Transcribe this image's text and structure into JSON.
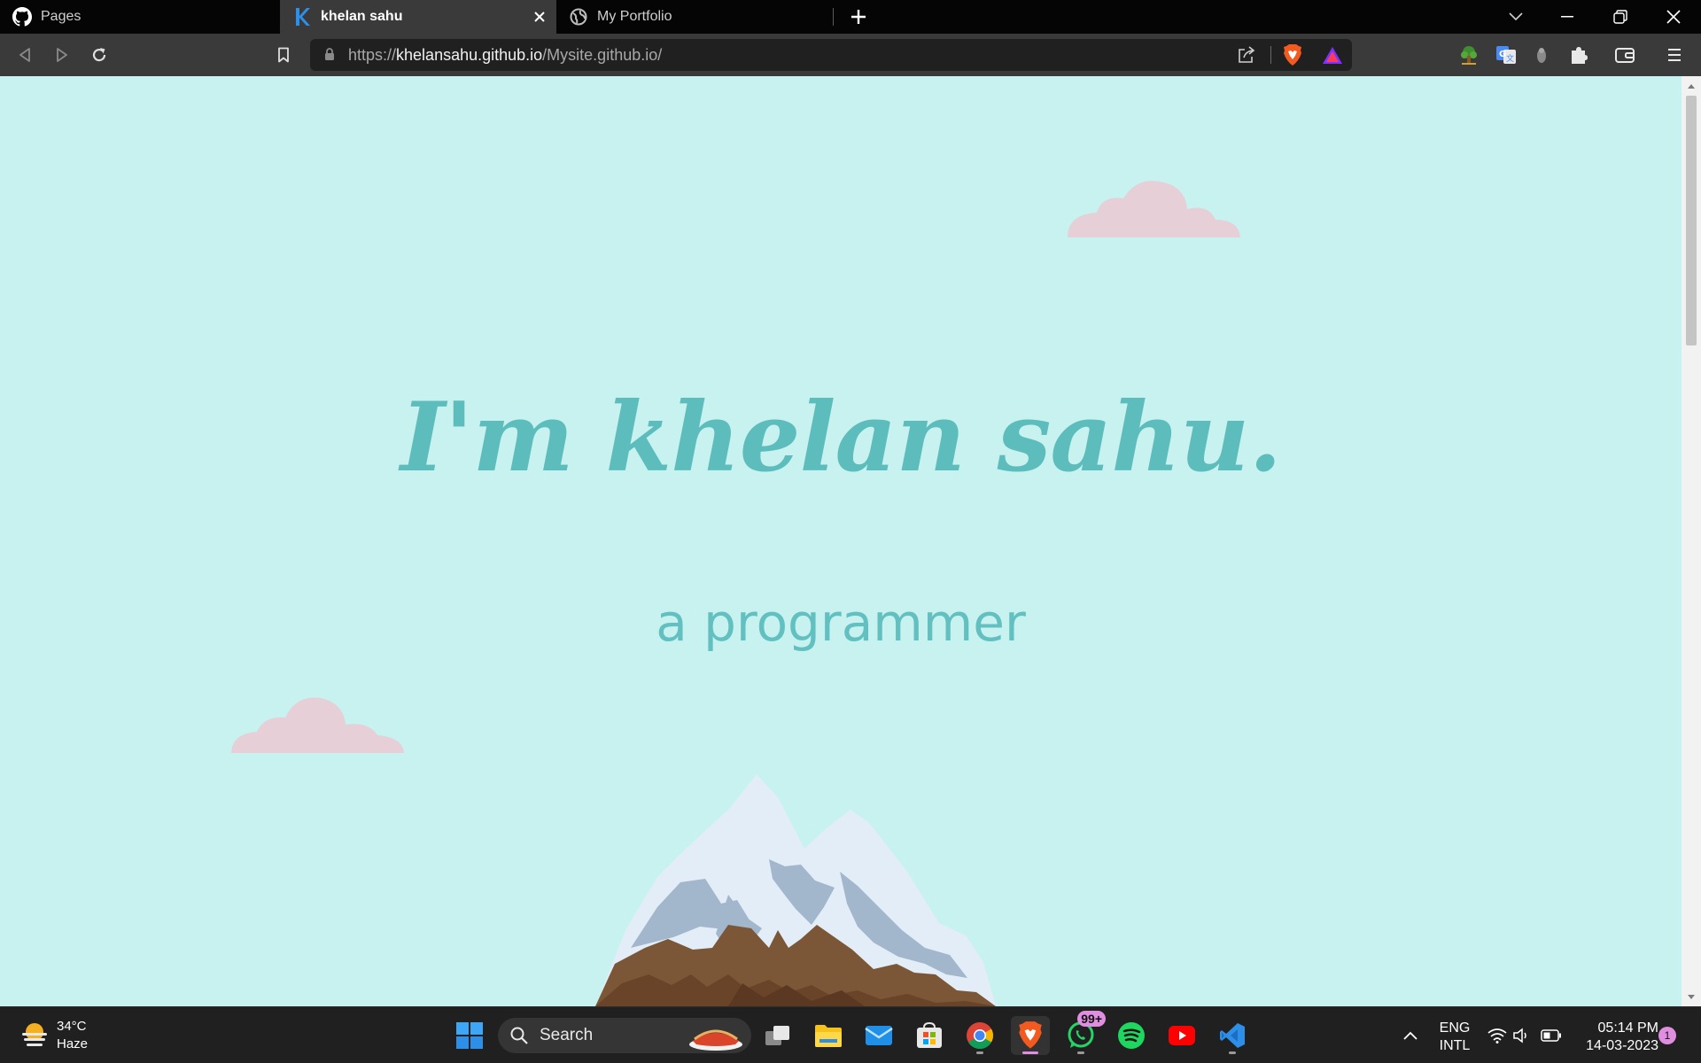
{
  "tabs": [
    {
      "label": "Pages",
      "icon": "github-icon",
      "active": false
    },
    {
      "label": "khelan sahu",
      "icon": "k-favicon-icon",
      "active": true
    },
    {
      "label": "My Portfolio",
      "icon": "globe-icon",
      "active": false
    }
  ],
  "address_bar": {
    "scheme": "https://",
    "host": "khelansahu.github.io",
    "path": "/Mysite.github.io/"
  },
  "page": {
    "title": "I'm khelan sahu.",
    "subtitle": "a programmer",
    "colors": {
      "background": "#c8f2f0",
      "text": "#5dbdbd",
      "cloud": "#e6cfd6",
      "snow": "#e2edf8",
      "shadow": "#a2b6cc",
      "rock": "#7b5637",
      "rock_dark": "#6a4428"
    }
  },
  "taskbar": {
    "weather": {
      "temp": "34°C",
      "condition": "Haze"
    },
    "search_label": "Search",
    "whatsapp_badge": "99+",
    "language": {
      "line1": "ENG",
      "line2": "INTL"
    },
    "time": "05:14 PM",
    "date": "14-03-2023",
    "notification_count": "1"
  }
}
